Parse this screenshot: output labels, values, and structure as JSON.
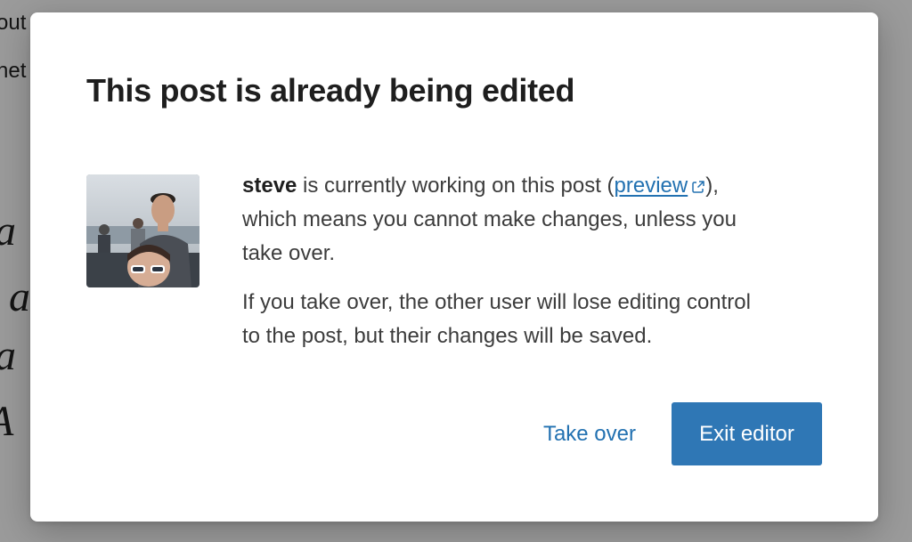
{
  "background": {
    "lines": [
      "out",
      "net",
      "a",
      "a",
      "a",
      "A"
    ]
  },
  "modal": {
    "title": "This post is already being edited",
    "avatar_alt": "steve",
    "message": {
      "username": "steve",
      "text_1": " is currently working on this post (",
      "preview_link": "preview",
      "text_2": "),",
      "text_3": "which means you cannot make changes, unless you",
      "text_4": "take over."
    },
    "takeover_note_line1": "If you take over, the other user will lose editing control",
    "takeover_note_line2": "to the post, but their changes will be saved.",
    "buttons": {
      "take_over": "Take over",
      "exit_editor": "Exit editor"
    }
  },
  "colors": {
    "accent": "#2271b1",
    "primary_button": "#2f77b5",
    "overlay": "#9b9b9b"
  },
  "icons": {
    "external_link": "external-link-icon"
  }
}
